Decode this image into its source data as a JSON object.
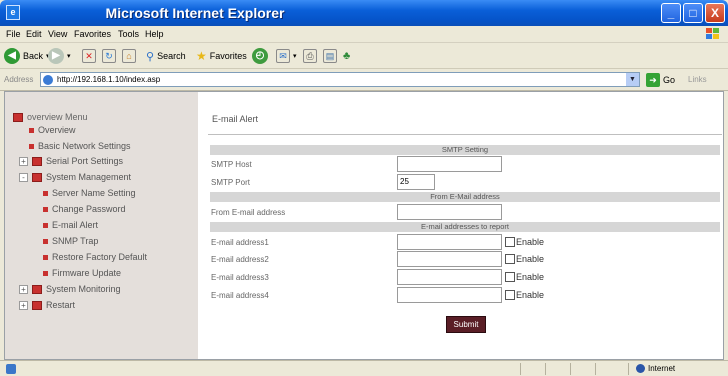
{
  "window": {
    "title": "Microsoft Internet Explorer",
    "min_glyph": "_",
    "max_glyph": "□",
    "close_glyph": "X"
  },
  "menu": [
    "File",
    "Edit",
    "View",
    "Favorites",
    "Tools",
    "Help"
  ],
  "toolbar": {
    "back_label": "Back",
    "search_label": "Search",
    "favorites_label": "Favorites"
  },
  "address": {
    "label": "Address",
    "url": "http://192.168.1.10/index.asp",
    "go_label": "Go",
    "links_label": "Links"
  },
  "sidebar": {
    "root_label": "overview Menu",
    "items": [
      {
        "label": "Overview",
        "kind": "leaf"
      },
      {
        "label": "Basic Network Settings",
        "kind": "leaf"
      },
      {
        "label": "Serial Port Settings",
        "kind": "folder",
        "expander": "+"
      },
      {
        "label": "System Management",
        "kind": "folder",
        "expander": "-"
      },
      {
        "label": "Server Name Setting",
        "kind": "leaf"
      },
      {
        "label": "Change Password",
        "kind": "leaf"
      },
      {
        "label": "E-mail Alert",
        "kind": "leaf"
      },
      {
        "label": "SNMP Trap",
        "kind": "leaf"
      },
      {
        "label": "Restore Factory Default",
        "kind": "leaf"
      },
      {
        "label": "Firmware Update",
        "kind": "leaf"
      },
      {
        "label": "System Monitoring",
        "kind": "folder",
        "expander": "+"
      },
      {
        "label": "Restart",
        "kind": "folder",
        "expander": "+"
      }
    ]
  },
  "content": {
    "page_title": "E-mail Alert",
    "smtp_header": "SMTP Setting",
    "smtp_host_label": "SMTP Host",
    "smtp_host_value": "",
    "smtp_port_label": "SMTP Port",
    "smtp_port_value": "25",
    "from_header": "From E-Mail address",
    "from_label": "From E-mail address",
    "from_value": "",
    "report_header": "E-mail addresses to report",
    "addresses": [
      {
        "label": "E-mail address1",
        "value": "",
        "enable_label": "Enable"
      },
      {
        "label": "E-mail address2",
        "value": "",
        "enable_label": "Enable"
      },
      {
        "label": "E-mail address3",
        "value": "",
        "enable_label": "Enable"
      },
      {
        "label": "E-mail address4",
        "value": "",
        "enable_label": "Enable"
      }
    ],
    "submit_label": "Submit"
  },
  "status": {
    "zone": "Internet"
  },
  "colors": {
    "titlebar": "#0553c8",
    "sidebar_bg": "#e4dfdb",
    "section_bar": "#d6d6d6",
    "submit_bg": "#5a1e26",
    "folder_red": "#c8312f"
  }
}
